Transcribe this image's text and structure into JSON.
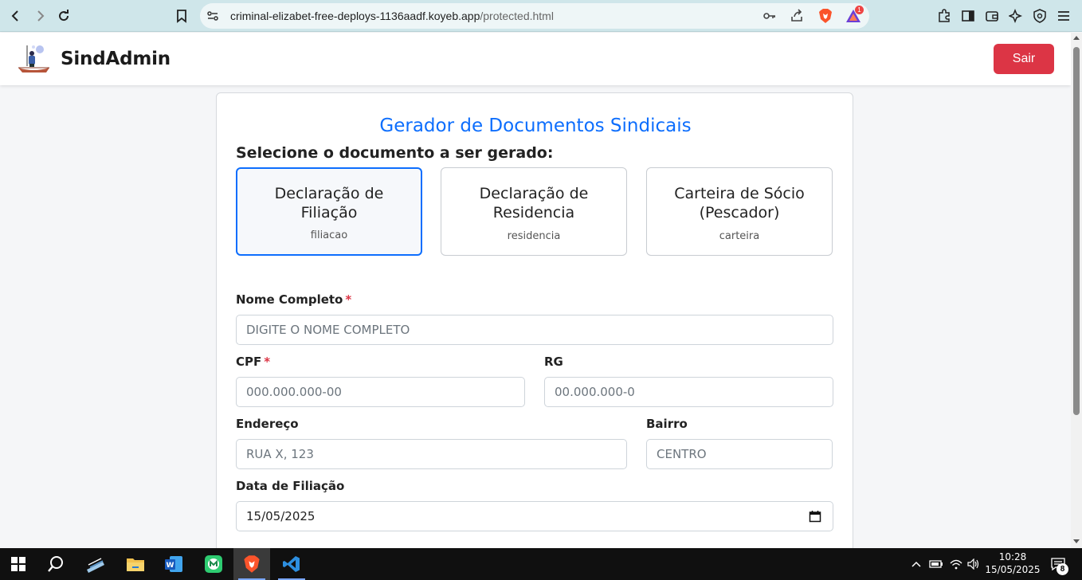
{
  "browser": {
    "url_host": "criminal-elizabet-free-deploys-1136aadf.koyeb.app",
    "url_path": "/protected.html",
    "brave_badge": "1",
    "icons": [
      "back-icon",
      "forward-icon",
      "reload-icon",
      "bookmark-icon",
      "site-settings-icon",
      "password-key-icon",
      "share-icon",
      "brave-shield-icon",
      "brave-rewards-icon",
      "extensions-icon",
      "sidebar-icon",
      "wallet-icon",
      "leo-ai-icon",
      "vpn-icon",
      "menu-icon"
    ]
  },
  "header": {
    "brand": "SindAdmin",
    "logout_label": "Sair"
  },
  "form": {
    "title": "Gerador de Documentos Sindicais",
    "select_label": "Selecione o documento a ser gerado:",
    "documents": [
      {
        "title": "Declaração de Filiação",
        "code": "filiacao",
        "selected": true
      },
      {
        "title": "Declaração de Residencia",
        "code": "residencia",
        "selected": false
      },
      {
        "title": "Carteira de Sócio (Pescador)",
        "code": "carteira",
        "selected": false
      }
    ],
    "nome_label": "Nome Completo",
    "nome_placeholder": "DIGITE O NOME COMPLETO",
    "cpf_label": "CPF",
    "cpf_placeholder": "000.000.000-00",
    "rg_label": "RG",
    "rg_placeholder": "00.000.000-0",
    "endereco_label": "Endereço",
    "endereco_placeholder": "RUA X, 123",
    "bairro_label": "Bairro",
    "bairro_placeholder": "CENTRO",
    "data_label": "Data de Filiação",
    "data_value": "15/05/2025",
    "required_mark": "*"
  },
  "taskbar": {
    "apps": [
      "start-icon",
      "search-icon",
      "scanner-app-icon",
      "file-explorer-icon",
      "word-icon",
      "app-m-icon",
      "brave-browser-icon",
      "vscode-icon"
    ],
    "time": "10:28",
    "date": "15/05/2025",
    "notifications": "8"
  },
  "colors": {
    "accent": "#0d6efd",
    "danger": "#dc3545",
    "chrome": "#cfe6ea"
  }
}
